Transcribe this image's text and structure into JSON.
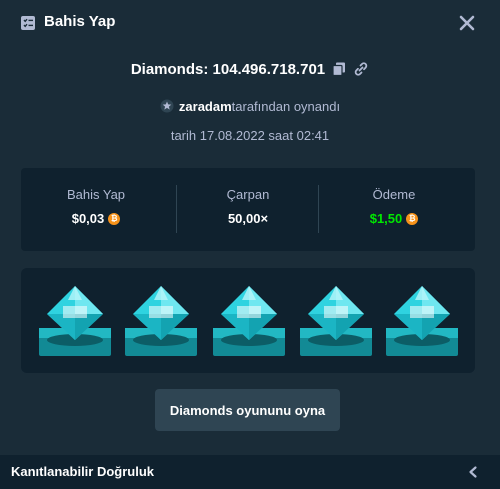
{
  "header": {
    "title": "Bahis Yap"
  },
  "game": {
    "name": "Diamonds: 104.496.718.701"
  },
  "player": {
    "username": "zaradam",
    "suffix": "tarafından oynandı"
  },
  "date": {
    "text": "tarih 17.08.2022 saat 02:41"
  },
  "stats": {
    "bet_label": "Bahis Yap",
    "bet_value": "$0,03",
    "multiplier_label": "Çarpan",
    "multiplier_value": "50,00×",
    "payout_label": "Ödeme",
    "payout_value": "$1,50"
  },
  "colors": {
    "payout": "#00e701",
    "gem": "#2fd3e0",
    "currency": "#f7931a"
  },
  "gems": [
    "diamond-gem",
    "diamond-gem",
    "diamond-gem",
    "diamond-gem",
    "diamond-gem"
  ],
  "play_button": {
    "label": "Diamonds oyununu oyna"
  },
  "footer": {
    "title": "Kanıtlanabilir Doğruluk"
  }
}
